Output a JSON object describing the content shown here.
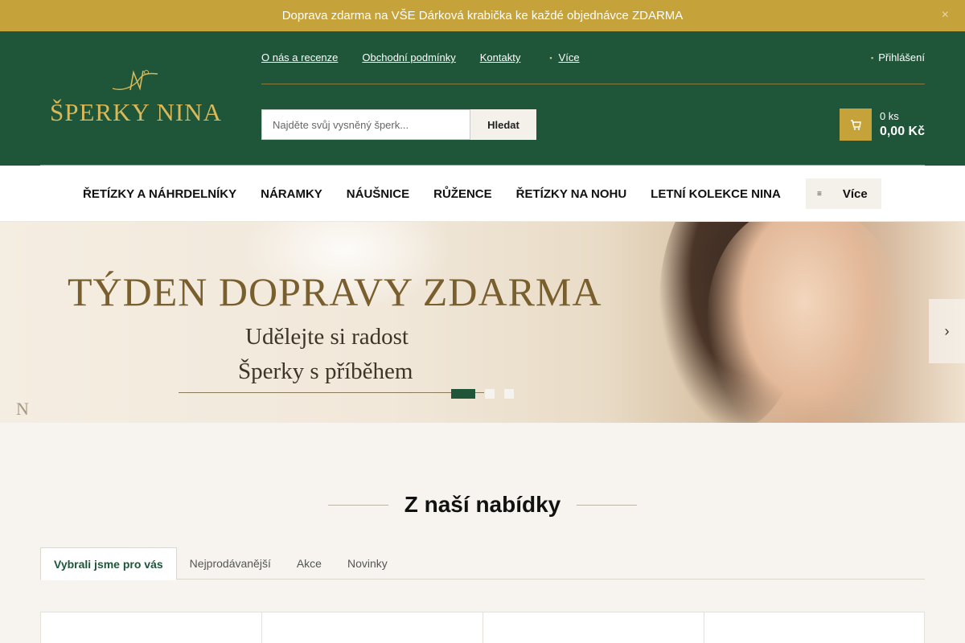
{
  "topbar": {
    "message": "Doprava zdarma na VŠE  Dárková krabička ke každé objednávce ZDARMA ",
    "close_icon": "×"
  },
  "header": {
    "logo_text": "ŠPERKY NINA",
    "links": {
      "about": "O nás a recenze",
      "terms": "Obchodní podmínky",
      "contacts": "Kontakty",
      "more": "Více"
    },
    "login": "Přihlášení",
    "search": {
      "placeholder": "Najděte svůj vysněný šperk...",
      "button": "Hledat"
    },
    "cart": {
      "qty": "0 ks",
      "price": "0,00 Kč"
    }
  },
  "nav": {
    "items": [
      "ŘETÍZKY A NÁHRDELNÍKY",
      "NÁRAMKY",
      "NÁUŠNICE",
      "RŮŽENCE",
      "ŘETÍZKY NA NOHU",
      "LETNÍ KOLEKCE NINA"
    ],
    "more": "Více"
  },
  "hero": {
    "title": "TÝDEN DOPRAVY ZDARMA",
    "subtitle1": "Udělejte si radost",
    "subtitle2": "Šperky s příběhem",
    "mark": "N"
  },
  "slider": {
    "dots": [
      "1",
      "2",
      "3"
    ],
    "active": 1
  },
  "section": {
    "title": "Z naší nabídky"
  },
  "tabs": {
    "items": [
      "Vybrali jsme pro vás",
      "Nejprodávanější",
      "Akce",
      "Novinky"
    ],
    "active": "Vybrali jsme pro vás"
  },
  "colors": {
    "brand_green": "#1f5538",
    "gold": "#c6a23a",
    "background": "#f7f4ef"
  },
  "icons": {
    "cart": "cart-icon",
    "user": "user-icon",
    "more": "menu-icon",
    "next": "chevron-right-icon",
    "close": "close-icon"
  }
}
